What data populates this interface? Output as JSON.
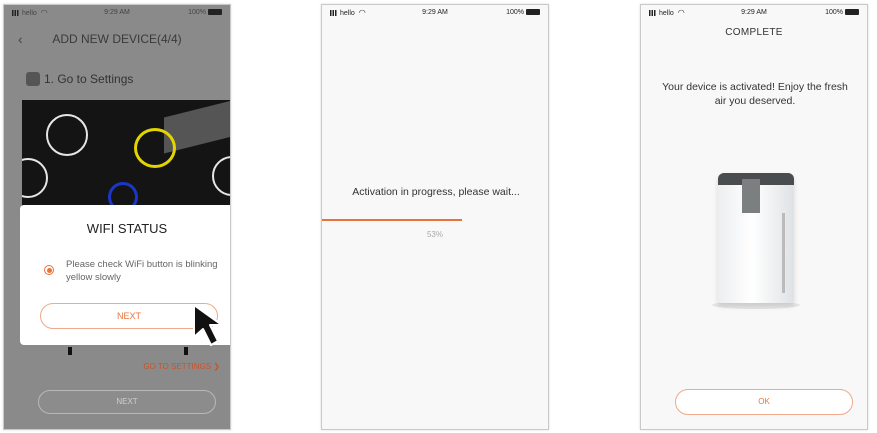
{
  "status": {
    "carrier": "hello",
    "time": "9:29 AM",
    "battery": "100%"
  },
  "screen1": {
    "title": "ADD NEW DEVICE(4/4)",
    "back_icon": "chevron-left-icon",
    "step": "1. Go to Settings",
    "dialog_title": "WIFI STATUS",
    "dialog_text": "Please check WiFi button is blinking yellow slowly",
    "dialog_button": "NEXT",
    "go_to_settings": "GO TO SETTINGS ❯",
    "next_button": "NEXT"
  },
  "screen2": {
    "message": "Activation in progress, please wait...",
    "progress_pct": "53%",
    "progress_value": 0.53
  },
  "screen3": {
    "title": "COMPLETE",
    "message": "Your device is activated! Enjoy the fresh air you deserved.",
    "ok_button": "OK"
  },
  "colors": {
    "accent": "#e8733f",
    "dim_overlay": "#8a8a8a",
    "screen_bg": "#f8f8f8"
  }
}
